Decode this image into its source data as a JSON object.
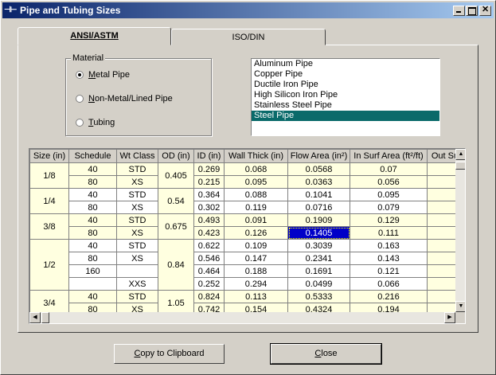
{
  "window": {
    "title": "Pipe and Tubing Sizes",
    "icon": "pipe-app-icon"
  },
  "tabs": [
    {
      "label": "ANSI/ASTM",
      "active": true
    },
    {
      "label": "ISO/DIN",
      "active": false
    }
  ],
  "material": {
    "legend": "Material",
    "options": [
      {
        "mnemonic": "M",
        "rest": "etal Pipe",
        "selected": true
      },
      {
        "mnemonic": "N",
        "rest": "on-Metal/Lined Pipe",
        "selected": false
      },
      {
        "mnemonic": "T",
        "rest": "ubing",
        "selected": false
      }
    ]
  },
  "material_list": {
    "items": [
      "Aluminum Pipe",
      "Copper Pipe",
      "Ductile Iron Pipe",
      "High Silicon Iron Pipe",
      "Stainless Steel Pipe",
      "Steel Pipe"
    ],
    "selected": "Steel Pipe",
    "selected_color": "#0a6a6a"
  },
  "grid": {
    "headers": [
      "Size (in)",
      "Schedule",
      "Wt Class",
      "OD (in)",
      "ID (in)",
      "Wall Thick (in)",
      "Flow Area (in²)",
      "In Surf Area (ft²/ft)",
      "Out Su"
    ],
    "rows": [
      [
        "1/8",
        "40",
        "STD",
        "0.405",
        "0.269",
        "0.068",
        "0.0568",
        "0.07",
        ""
      ],
      [
        "",
        "80",
        "XS",
        "",
        "0.215",
        "0.095",
        "0.0363",
        "0.056",
        ""
      ],
      [
        "1/4",
        "40",
        "STD",
        "0.54",
        "0.364",
        "0.088",
        "0.1041",
        "0.095",
        ""
      ],
      [
        "",
        "80",
        "XS",
        "",
        "0.302",
        "0.119",
        "0.0716",
        "0.079",
        ""
      ],
      [
        "3/8",
        "40",
        "STD",
        "0.675",
        "0.493",
        "0.091",
        "0.1909",
        "0.129",
        ""
      ],
      [
        "",
        "80",
        "XS",
        "",
        "0.423",
        "0.126",
        "0.1405",
        "0.111",
        ""
      ],
      [
        "1/2",
        "40",
        "STD",
        "0.84",
        "0.622",
        "0.109",
        "0.3039",
        "0.163",
        ""
      ],
      [
        "",
        "80",
        "XS",
        "",
        "0.546",
        "0.147",
        "0.2341",
        "0.143",
        ""
      ],
      [
        "",
        "160",
        "",
        "",
        "0.464",
        "0.188",
        "0.1691",
        "0.121",
        ""
      ],
      [
        "",
        "",
        "XXS",
        "",
        "0.252",
        "0.294",
        "0.0499",
        "0.066",
        ""
      ],
      [
        "3/4",
        "40",
        "STD",
        "1.05",
        "0.824",
        "0.113",
        "0.5333",
        "0.216",
        ""
      ],
      [
        "",
        "80",
        "XS",
        "",
        "0.742",
        "0.154",
        "0.4324",
        "0.194",
        ""
      ]
    ],
    "selected_cell_value": "0.1405",
    "colors": {
      "band_yellow": "#ffffe0",
      "selection": "#0000c8"
    }
  },
  "buttons": {
    "copy": {
      "mnemonic": "C",
      "rest": "opy to Clipboard"
    },
    "close": {
      "mnemonic": "C",
      "rest": "lose"
    }
  }
}
